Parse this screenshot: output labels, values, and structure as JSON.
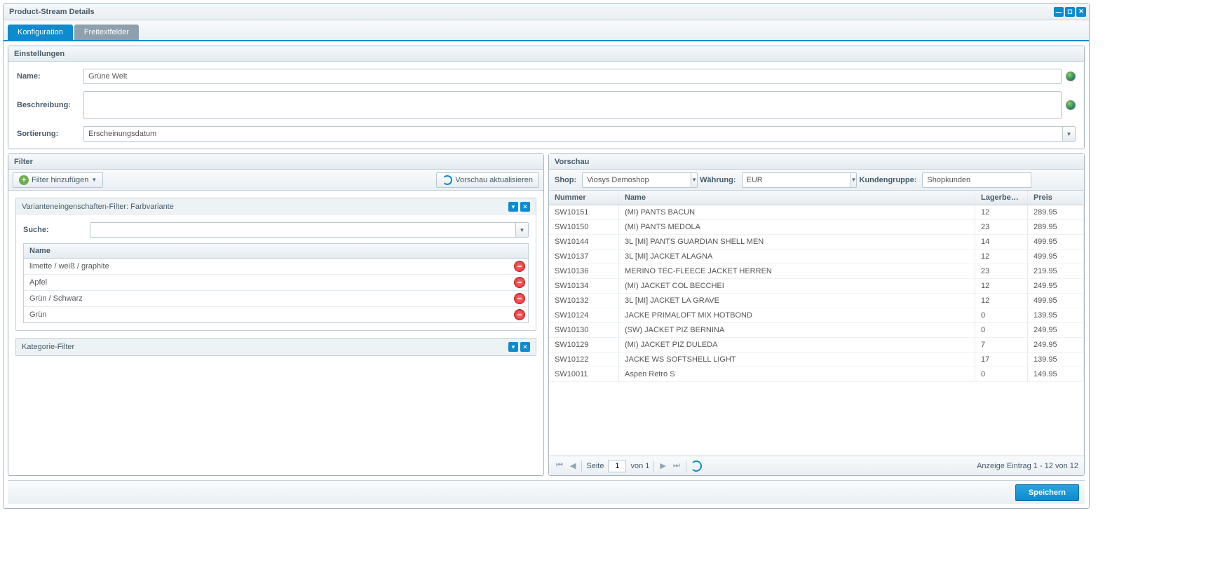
{
  "window_title": "Product-Stream Details",
  "tabs": {
    "config": "Konfiguration",
    "freetext": "Freitextfelder"
  },
  "settings": {
    "head": "Einstellungen",
    "name_label": "Name:",
    "name_value": "Grüne Welt",
    "desc_label": "Beschreibung:",
    "desc_value": "",
    "sort_label": "Sortierung:",
    "sort_value": "Erscheinungsdatum"
  },
  "filter_panel": {
    "head": "Filter",
    "add_btn": "Filter hinzufügen",
    "refresh_btn": "Vorschau aktualisieren",
    "variant_filter_title": "Varianteneingenschaften-Filter: Farbvariante",
    "search_label": "Suche:",
    "grid_header": "Name",
    "items": [
      "limette / weiß / graphite",
      "Apfel",
      "Grün / Schwarz",
      "Grün"
    ],
    "category_filter_title": "Kategorie-Filter"
  },
  "preview_panel": {
    "head": "Vorschau",
    "shop_label": "Shop:",
    "shop_value": "Viosys Demoshop",
    "currency_label": "Währung:",
    "currency_value": "EUR",
    "custgroup_label": "Kundengruppe:",
    "custgroup_value": "Shopkunden",
    "columns": {
      "num": "Nummer",
      "name": "Name",
      "stock": "Lagerbesta",
      "price": "Preis"
    },
    "rows": [
      {
        "num": "SW10151",
        "name": "(MI) PANTS BACUN",
        "stock": "12",
        "price": "289.95"
      },
      {
        "num": "SW10150",
        "name": "(MI) PANTS MEDOLA",
        "stock": "23",
        "price": "289.95"
      },
      {
        "num": "SW10144",
        "name": "3L [MI] PANTS GUARDIAN SHELL MEN",
        "stock": "14",
        "price": "499.95"
      },
      {
        "num": "SW10137",
        "name": "3L [MI] JACKET ALAGNA",
        "stock": "12",
        "price": "499.95"
      },
      {
        "num": "SW10136",
        "name": "MERINO TEC-FLEECE JACKET HERREN",
        "stock": "23",
        "price": "219.95"
      },
      {
        "num": "SW10134",
        "name": "(MI) JACKET COL BECCHEI",
        "stock": "12",
        "price": "249.95"
      },
      {
        "num": "SW10132",
        "name": "3L [MI] JACKET LA GRAVE",
        "stock": "12",
        "price": "499.95"
      },
      {
        "num": "SW10124",
        "name": "JACKE PRIMALOFT MIX HOTBOND",
        "stock": "0",
        "price": "139.95"
      },
      {
        "num": "SW10130",
        "name": "(SW) JACKET PIZ BERNINA",
        "stock": "0",
        "price": "249.95"
      },
      {
        "num": "SW10129",
        "name": "(MI) JACKET PIZ DULEDA",
        "stock": "7",
        "price": "249.95"
      },
      {
        "num": "SW10122",
        "name": "JACKE WS SOFTSHELL LIGHT",
        "stock": "17",
        "price": "139.95"
      },
      {
        "num": "SW10011",
        "name": "Aspen Retro S",
        "stock": "0",
        "price": "149.95"
      }
    ]
  },
  "pager": {
    "page_label": "Seite",
    "page_value": "1",
    "of_label": "von 1",
    "display": "Anzeige Eintrag 1 - 12 von 12"
  },
  "footer": {
    "save": "Speichern"
  }
}
